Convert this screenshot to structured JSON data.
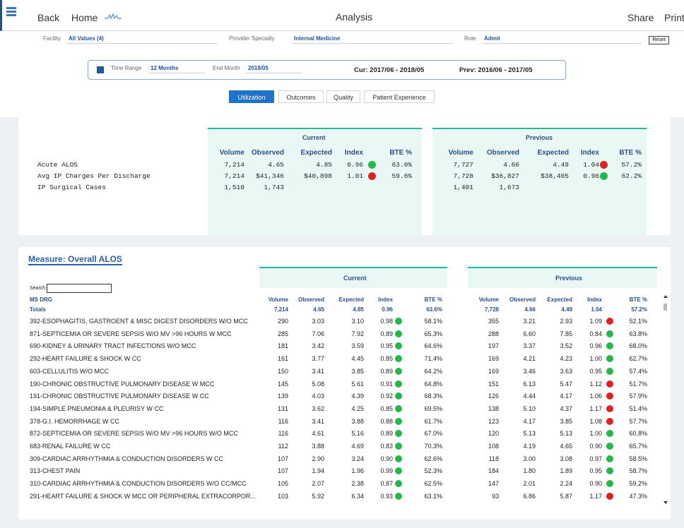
{
  "topbar": {
    "back": "Back",
    "home": "Home",
    "title": "Analysis",
    "share": "Share",
    "print": "Print"
  },
  "filters": {
    "facility_label": "Facility",
    "facility": "All Values (4)",
    "specialty_label": "Provider Specialty",
    "specialty": "Internal Medicine",
    "role_label": "Role",
    "role": "Admit",
    "reset": "Reset"
  },
  "time": {
    "range_label": "Time Range",
    "range": "12 Months",
    "end_label": "End Month",
    "end": "2018/05",
    "cur": "Cur: 2017/06 - 2018/05",
    "prev": "Prev: 2016/06 - 2017/05"
  },
  "tabs": [
    "Utilization",
    "Outcomes",
    "Quality",
    "Patient Experience"
  ],
  "summary": {
    "current_label": "Current",
    "previous_label": "Previous",
    "cols": [
      "Volume",
      "Observed",
      "Expected",
      "Index",
      "BTE %"
    ],
    "rows": [
      {
        "name": "Acute ALOS",
        "cur": [
          "7,214",
          "4.65",
          "4.85",
          "0.96",
          "63.6%"
        ],
        "cur_dot": "green",
        "prev": [
          "7,727",
          "4.66",
          "4.49",
          "1.04",
          "57.2%"
        ],
        "prev_dot": "red"
      },
      {
        "name": "Avg IP Charges Per Discharge",
        "cur": [
          "7,214",
          "$41,346",
          "$40,898",
          "1.01",
          "59.6%"
        ],
        "cur_dot": "red",
        "prev": [
          "7,728",
          "$36,827",
          "$38,405",
          "0.96",
          "62.2%"
        ],
        "prev_dot": "green"
      },
      {
        "name": "IP Surgical Cases",
        "cur": [
          "1,510",
          "1,743",
          "",
          "",
          ""
        ],
        "cur_dot": "",
        "prev": [
          "1,401",
          "1,673",
          "",
          "",
          ""
        ],
        "prev_dot": ""
      }
    ]
  },
  "measure": {
    "title": "Measure: Overall ALOS",
    "search_label": "Search:",
    "drg_header": "MS DRG",
    "current_label": "Current",
    "previous_label": "Previous",
    "cols": [
      "Volume",
      "Observed",
      "Expected",
      "Index",
      "BTE %"
    ],
    "totals": {
      "name": "Totals",
      "cur": [
        "7,214",
        "4.65",
        "4.85",
        "0.96",
        "63.6%"
      ],
      "prev": [
        "7,728",
        "4.66",
        "4.49",
        "1.04",
        "57.2%"
      ]
    },
    "rows": [
      {
        "name": "392-ESOPHAGITIS, GASTROENT & MISC DIGEST DISORDERS W/O MCC",
        "cur": [
          "290",
          "3.03",
          "3.10",
          "0.98",
          "58.1%"
        ],
        "cd": "green",
        "prev": [
          "355",
          "3.21",
          "2.93",
          "1.09",
          "52.1%"
        ],
        "pd": "red"
      },
      {
        "name": "871-SEPTICEMIA OR SEVERE SEPSIS W/O MV >96 HOURS W MCC",
        "cur": [
          "285",
          "7.06",
          "7.92",
          "0.89",
          "65.3%"
        ],
        "cd": "green",
        "prev": [
          "288",
          "6.60",
          "7.85",
          "0.84",
          "63.8%"
        ],
        "pd": "green"
      },
      {
        "name": "690-KIDNEY & URINARY TRACT INFECTIONS W/O MCC",
        "cur": [
          "181",
          "3.42",
          "3.59",
          "0.95",
          "64.6%"
        ],
        "cd": "green",
        "prev": [
          "197",
          "3.37",
          "3.52",
          "0.96",
          "68.0%"
        ],
        "pd": "green"
      },
      {
        "name": "292-HEART FAILURE & SHOCK W CC",
        "cur": [
          "161",
          "3.77",
          "4.45",
          "0.85",
          "71.4%"
        ],
        "cd": "green",
        "prev": [
          "169",
          "4.21",
          "4.23",
          "1.00",
          "62.7%"
        ],
        "pd": "green"
      },
      {
        "name": "603-CELLULITIS W/O MCC",
        "cur": [
          "150",
          "3.41",
          "3.85",
          "0.89",
          "64.2%"
        ],
        "cd": "green",
        "prev": [
          "169",
          "3.46",
          "3.63",
          "0.95",
          "57.4%"
        ],
        "pd": "green"
      },
      {
        "name": "190-CHRONIC OBSTRUCTIVE PULMONARY DISEASE W MCC",
        "cur": [
          "145",
          "5.08",
          "5.61",
          "0.91",
          "64.8%"
        ],
        "cd": "green",
        "prev": [
          "151",
          "6.13",
          "5.47",
          "1.12",
          "51.7%"
        ],
        "pd": "red"
      },
      {
        "name": "191-CHRONIC OBSTRUCTIVE PULMONARY DISEASE W CC",
        "cur": [
          "139",
          "4.03",
          "4.39",
          "0.92",
          "68.3%"
        ],
        "cd": "green",
        "prev": [
          "126",
          "4.44",
          "4.17",
          "1.06",
          "57.9%"
        ],
        "pd": "red"
      },
      {
        "name": "194-SIMPLE PNEUMONIA & PLEURISY W CC",
        "cur": [
          "131",
          "3.62",
          "4.25",
          "0.85",
          "69.5%"
        ],
        "cd": "green",
        "prev": [
          "138",
          "5.10",
          "4.37",
          "1.17",
          "51.4%"
        ],
        "pd": "red"
      },
      {
        "name": "378-G.I. HEMORRHAGE W CC",
        "cur": [
          "116",
          "3.41",
          "3.88",
          "0.88",
          "61.7%"
        ],
        "cd": "green",
        "prev": [
          "123",
          "4.17",
          "3.85",
          "1.08",
          "57.7%"
        ],
        "pd": "red"
      },
      {
        "name": "872-SEPTICEMIA OR SEVERE SEPSIS W/O MV >96 HOURS W/O MCC",
        "cur": [
          "116",
          "4.61",
          "5.16",
          "0.89",
          "67.0%"
        ],
        "cd": "green",
        "prev": [
          "120",
          "5.13",
          "5.13",
          "1.00",
          "60.8%"
        ],
        "pd": "green"
      },
      {
        "name": "683-RENAL FAILURE W CC",
        "cur": [
          "112",
          "3.88",
          "4.69",
          "0.83",
          "70.3%"
        ],
        "cd": "green",
        "prev": [
          "108",
          "4.19",
          "4.65",
          "0.90",
          "65.7%"
        ],
        "pd": "green"
      },
      {
        "name": "309-CARDIAC ARRHYTHMIA & CONDUCTION DISORDERS W CC",
        "cur": [
          "107",
          "2.90",
          "3.24",
          "0.90",
          "62.6%"
        ],
        "cd": "green",
        "prev": [
          "118",
          "3.00",
          "3.08",
          "0.97",
          "58.5%"
        ],
        "pd": "green"
      },
      {
        "name": "313-CHEST PAIN",
        "cur": [
          "107",
          "1.94",
          "1.96",
          "0.99",
          "52.3%"
        ],
        "cd": "green",
        "prev": [
          "184",
          "1.80",
          "1.89",
          "0.95",
          "58.7%"
        ],
        "pd": "green"
      },
      {
        "name": "310-CARDIAC ARRHYTHMIA & CONDUCTION DISORDERS W/O CC/MCC",
        "cur": [
          "105",
          "2.07",
          "2.38",
          "0.87",
          "62.5%"
        ],
        "cd": "green",
        "prev": [
          "147",
          "2.01",
          "2.24",
          "0.90",
          "59.2%"
        ],
        "pd": "green"
      },
      {
        "name": "291-HEART FAILURE & SHOCK W MCC OR PERIPHERAL EXTRACORPOR...",
        "cur": [
          "103",
          "5.92",
          "6.34",
          "0.93",
          "63.1%"
        ],
        "cd": "green",
        "prev": [
          "93",
          "6.86",
          "5.87",
          "1.17",
          "47.3%"
        ],
        "pd": "red"
      }
    ]
  }
}
